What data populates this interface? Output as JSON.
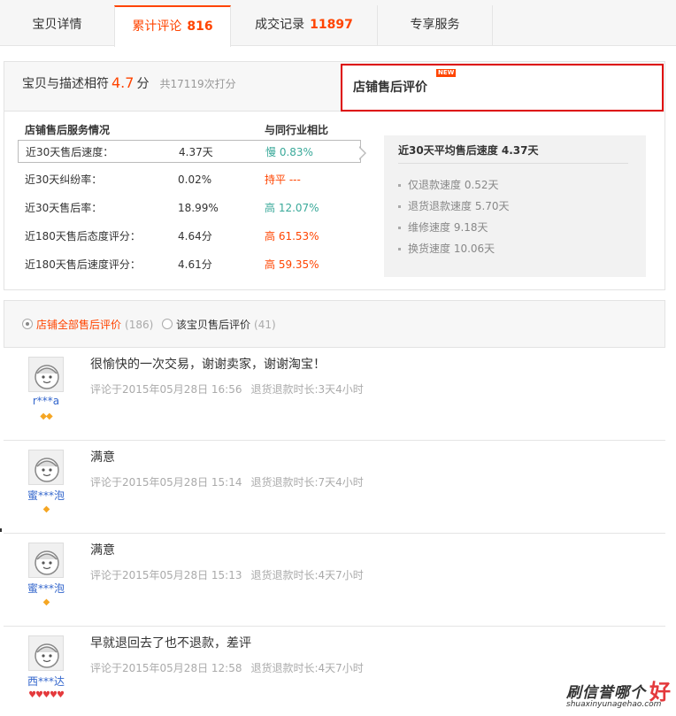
{
  "tabs": [
    {
      "label": "宝贝详情",
      "count": ""
    },
    {
      "label": "累计评论",
      "count": "816"
    },
    {
      "label": "成交记录",
      "count": "11897"
    },
    {
      "label": "专享服务",
      "count": ""
    }
  ],
  "summary": {
    "match_label": "宝贝与描述相符",
    "match_score": "4.7",
    "match_unit": "分",
    "match_total": "共17119次打分",
    "after_sales_tab": "店铺售后评价",
    "new_badge": "NEW",
    "col_service": "店铺售后服务情况",
    "col_compare": "与同行业相比",
    "rows": [
      {
        "name": "近30天售后速度：",
        "value": "4.37天",
        "compare": "慢 0.83%"
      },
      {
        "name": "近30天纠纷率：",
        "value": "0.02%",
        "compare": "持平 ---"
      },
      {
        "name": "近30天售后率：",
        "value": "18.99%",
        "compare": "高 12.07%"
      },
      {
        "name": "近180天售后态度评分：",
        "value": "4.64分",
        "compare": "高 61.53%"
      },
      {
        "name": "近180天售后速度评分：",
        "value": "4.61分",
        "compare": "高 59.35%"
      }
    ],
    "avg_title": "近30天平均售后速度 4.37天",
    "avg_items": [
      "仅退款速度 0.52天",
      "退货退款速度 5.70天",
      "维修速度 9.18天",
      "换货速度 10.06天"
    ]
  },
  "filter": {
    "all_label": "店铺全部售后评价",
    "all_count": "(186)",
    "item_label": "该宝贝售后评价",
    "item_count": "(41)"
  },
  "reviews": [
    {
      "user": "r***a",
      "content": "很愉快的一次交易，谢谢卖家，谢谢淘宝！",
      "time": "评论于2015年05月28日 16:56",
      "duration": "退货退款时长:3天4小时",
      "gems": "◆◆"
    },
    {
      "user": "蜜***泡",
      "content": "满意",
      "time": "评论于2015年05月28日 15:14",
      "duration": "退货退款时长:7天4小时",
      "gems": "◆"
    },
    {
      "user": "蜜***泡",
      "content": "满意",
      "time": "评论于2015年05月28日 15:13",
      "duration": "退货退款时长:4天7小时",
      "gems": "◆"
    },
    {
      "user": "西***达",
      "content": "早就退回去了也不退款，差评",
      "time": "评论于2015年05月28日 12:58",
      "duration": "退货退款时长:4天7小时",
      "gems": "♥♥♥♥♥"
    }
  ],
  "watermark": {
    "cn": "刷信誉哪个",
    "big": "好",
    "url": "shuaxinyunagehao.com"
  },
  "colors": {
    "accent": "#ff4400",
    "green": "#3aa99a",
    "link": "#3366cc",
    "highlight_border": "#dd0000"
  }
}
